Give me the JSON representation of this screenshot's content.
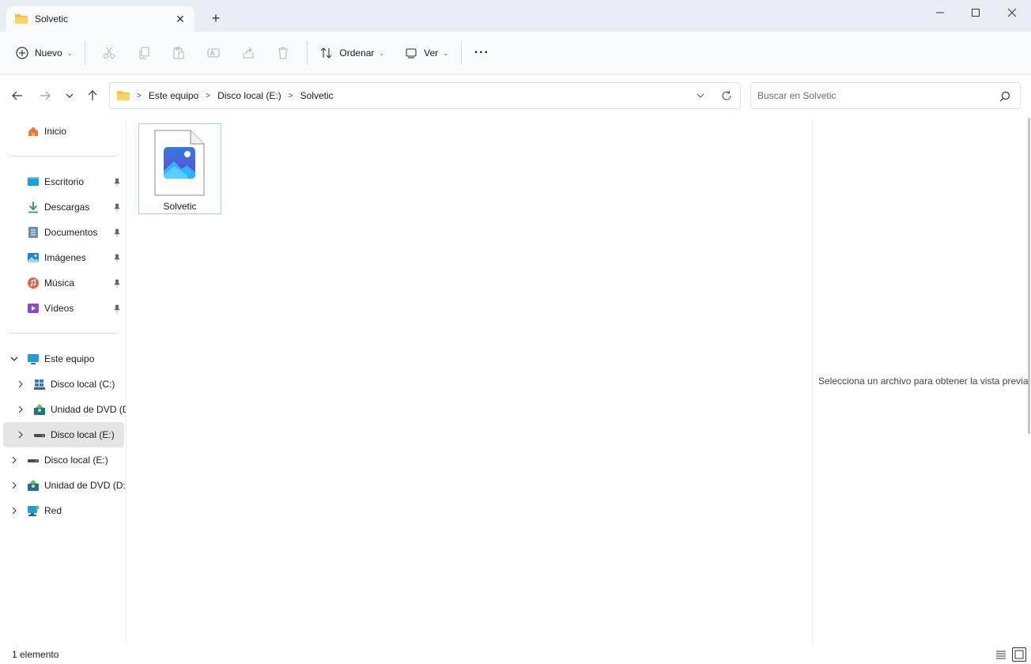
{
  "window": {
    "tab_title": "Solvetic",
    "new_tab_symbol": "+",
    "close_tab_symbol": "✕"
  },
  "toolbar": {
    "new_label": "Nuevo",
    "sort_label": "Ordenar",
    "view_label": "Ver",
    "more_label": "···"
  },
  "address": {
    "crumbs": [
      "Este equipo",
      "Disco local (E:)",
      "Solvetic"
    ],
    "search_placeholder": "Buscar en Solvetic"
  },
  "sidebar": {
    "home": "Inicio",
    "quick_access": [
      {
        "label": "Escritorio",
        "icon": "desktop-icon"
      },
      {
        "label": "Descargas",
        "icon": "download-icon"
      },
      {
        "label": "Documentos",
        "icon": "documents-icon"
      },
      {
        "label": "Imágenes",
        "icon": "pictures-icon"
      },
      {
        "label": "Música",
        "icon": "music-icon"
      },
      {
        "label": "Vídeos",
        "icon": "videos-icon"
      }
    ],
    "this_pc": "Este equipo",
    "this_pc_children": [
      {
        "label": "Disco local (C:)",
        "icon": "windows-drive-icon"
      },
      {
        "label": "Unidad de DVD (D",
        "icon": "dvd-drive-icon"
      },
      {
        "label": "Disco local (E:)",
        "icon": "drive-icon"
      }
    ],
    "root_items": [
      {
        "label": "Disco local (E:)",
        "icon": "drive-icon"
      },
      {
        "label": "Unidad de DVD (D:)",
        "icon": "dvd-drive-icon"
      },
      {
        "label": "Red",
        "icon": "network-icon"
      }
    ]
  },
  "files": [
    {
      "name": "Solvetic",
      "icon": "image-file-icon"
    }
  ],
  "preview": {
    "message": "Selecciona un archivo para obtener la vista previa."
  },
  "status": {
    "count": "1 elemento"
  },
  "colors": {
    "accent": "#0067c0",
    "titlebar": "#e8eef4",
    "selection_border": "#99d1ff",
    "folder": "#f8c43a"
  }
}
